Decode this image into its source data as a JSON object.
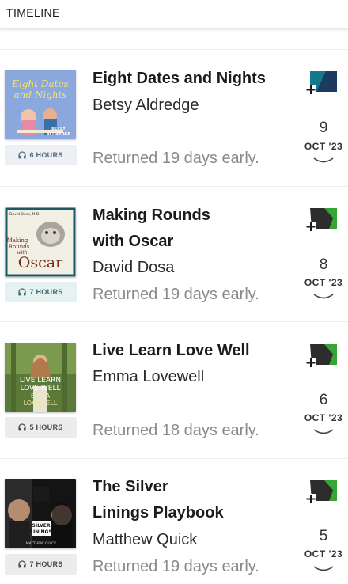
{
  "header": {
    "title": "TIMELINE"
  },
  "colors": {
    "tag_default": "#2d2d2d",
    "tag_teal": "#127a8a",
    "tag_navy": "#1d3a60",
    "tag_green": "#37a534"
  },
  "entries": [
    {
      "title_lines": [
        "Eight Dates and Nights"
      ],
      "author": "Betsy Aldredge",
      "status": "Returned 19 days early.",
      "duration": "6 HOURS",
      "day": "9",
      "month_year": "OCT '23",
      "cover": {
        "line1": "Eight Dates",
        "line2": "and Nights",
        "byline_a": "BETSY",
        "byline_b": "ALDREDGE"
      }
    },
    {
      "title_lines": [
        "Making Rounds",
        "with Oscar"
      ],
      "author": "David Dosa",
      "status": "Returned 19 days early.",
      "duration": "7 HOURS",
      "day": "8",
      "month_year": "OCT '23",
      "cover": {
        "line1": "David Dosa, M.D.",
        "line2": "Making",
        "line3": "Rounds",
        "line4": "with",
        "line5": "Oscar"
      }
    },
    {
      "title_lines": [
        "Live Learn Love Well"
      ],
      "author": "Emma Lovewell",
      "status": "Returned 18 days early.",
      "duration": "5 HOURS",
      "day": "6",
      "month_year": "OCT '23",
      "cover": {
        "line1": "LIVE LEARN",
        "line2": "LOVE WELL",
        "line3": "EMMA",
        "line4": "LOVEWELL"
      }
    },
    {
      "title_lines": [
        "The Silver",
        "Linings Playbook"
      ],
      "author": "Matthew Quick",
      "status": "Returned 19 days early.",
      "duration": "7 HOURS",
      "day": "5",
      "month_year": "OCT '23",
      "cover": {
        "line1": "SILVER",
        "line2": "LININGS",
        "line3": "MATTHEW QUICK"
      }
    }
  ]
}
